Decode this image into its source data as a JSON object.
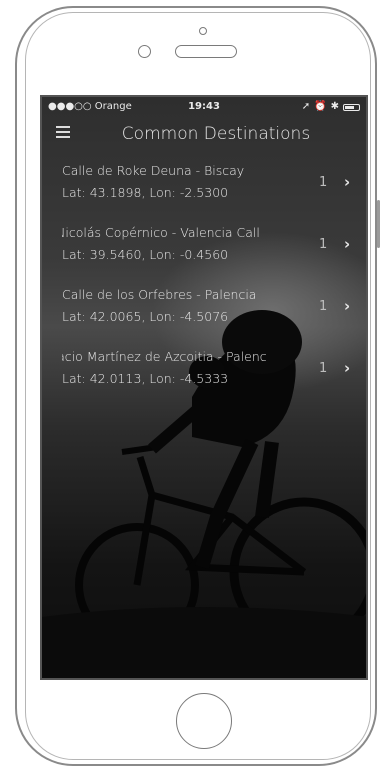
{
  "status_bar": {
    "carrier": "●●●○○ Orange",
    "time": "19:43"
  },
  "nav": {
    "title": "Common Destinations",
    "menu_icon": "hamburger-menu-icon"
  },
  "destinations": [
    {
      "title": "Calle de Roke Deuna - Biscay",
      "coords": "Lat: 43.1898, Lon: -2.5300",
      "count": "1"
    },
    {
      "title": "Nicolás Copérnico - Valencia Call",
      "coords": "Lat: 39.5460, Lon: -0.4560",
      "count": "1"
    },
    {
      "title": "Calle de los Orfebres - Palencia",
      "coords": "Lat: 42.0065, Lon: -4.5076",
      "count": "1"
    },
    {
      "title": "Ignacio Martínez de Azcoitia - Palenc",
      "coords": "Lat: 42.0113, Lon: -4.5333",
      "count": "1"
    }
  ],
  "colors": {
    "text": "#e9e9e9",
    "background_dark": "#0c0c0c",
    "frame": "#8a8a8a"
  }
}
